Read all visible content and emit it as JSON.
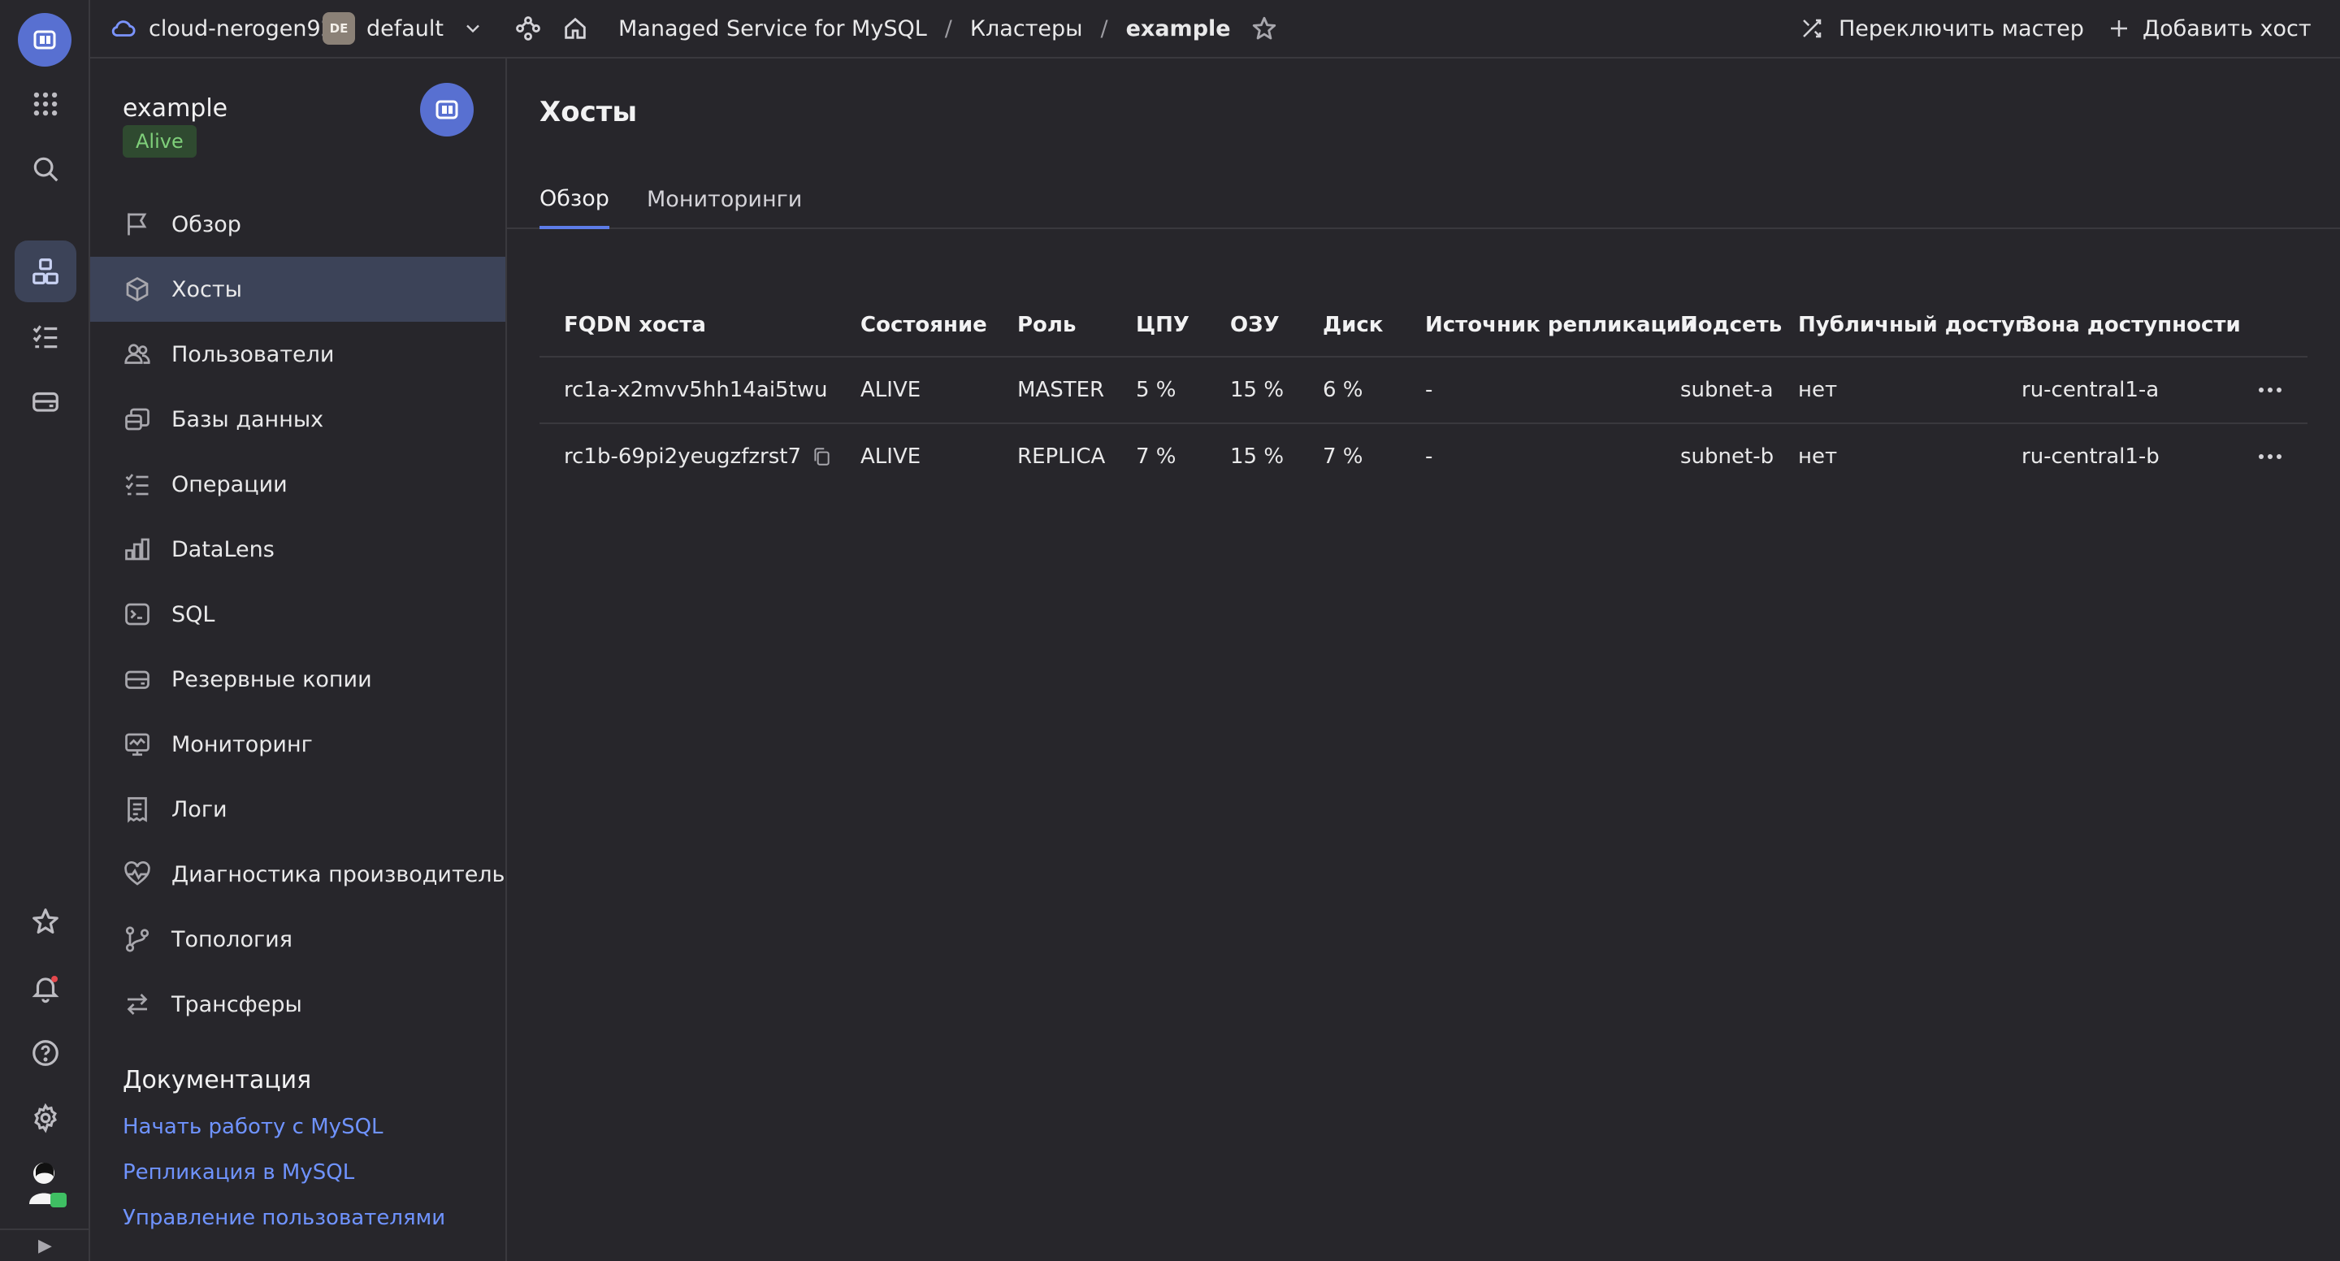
{
  "topbar": {
    "cloud_name": "cloud-nerogen92",
    "folder_badge": "DE",
    "folder_name": "default",
    "breadcrumbs": [
      "Managed Service for MySQL",
      "Кластеры",
      "example"
    ],
    "separator": "/",
    "switch_wizard_label": "Переключить мастер",
    "add_host_label": "Добавить хост"
  },
  "cluster": {
    "name": "example",
    "status": "Alive"
  },
  "sidebar": {
    "items": [
      {
        "label": "Обзор",
        "icon": "flag-icon"
      },
      {
        "label": "Хосты",
        "icon": "cube-icon"
      },
      {
        "label": "Пользователи",
        "icon": "users-icon"
      },
      {
        "label": "Базы данных",
        "icon": "databases-icon"
      },
      {
        "label": "Операции",
        "icon": "list-check-icon"
      },
      {
        "label": "DataLens",
        "icon": "chart-bars-icon"
      },
      {
        "label": "SQL",
        "icon": "terminal-icon"
      },
      {
        "label": "Резервные копии",
        "icon": "backup-icon"
      },
      {
        "label": "Мониторинг",
        "icon": "monitor-icon"
      },
      {
        "label": "Логи",
        "icon": "logs-icon"
      },
      {
        "label": "Диагностика производитель...",
        "icon": "heart-pulse-icon"
      },
      {
        "label": "Топология",
        "icon": "topology-icon"
      },
      {
        "label": "Трансферы",
        "icon": "arrows-swap-icon"
      }
    ],
    "active_index": 1,
    "docs_title": "Документация",
    "doc_links": [
      "Начать работу с MySQL",
      "Репликация в MySQL",
      "Управление пользователями"
    ]
  },
  "main": {
    "title": "Хосты",
    "tabs": [
      "Обзор",
      "Мониторинги"
    ],
    "active_tab": 0
  },
  "table": {
    "columns": [
      "FQDN хоста",
      "Состояние",
      "Роль",
      "ЦПУ",
      "ОЗУ",
      "Диск",
      "Источник репликации",
      "Подсеть",
      "Публичный доступ",
      "Зона доступности"
    ],
    "rows": [
      {
        "fqdn": "rc1a-x2mvv5hh14ai5twu",
        "state": "ALIVE",
        "role": "MASTER",
        "cpu": "5 %",
        "ram": "15 %",
        "disk": "6 %",
        "source": "-",
        "subnet": "subnet-a",
        "public": "нет",
        "zone": "ru-central1-a"
      },
      {
        "fqdn": "rc1b-69pi2yeugzfzrst7",
        "state": "ALIVE",
        "role": "REPLICA",
        "cpu": "7 %",
        "ram": "15 %",
        "disk": "7 %",
        "source": "-",
        "subnet": "subnet-b",
        "public": "нет",
        "zone": "ru-central1-b"
      }
    ]
  },
  "colors": {
    "accent": "#5870d1",
    "link": "#6f93ff",
    "alive": "#75c36e",
    "active_nav": "#3c4358",
    "background": "#27262b"
  }
}
